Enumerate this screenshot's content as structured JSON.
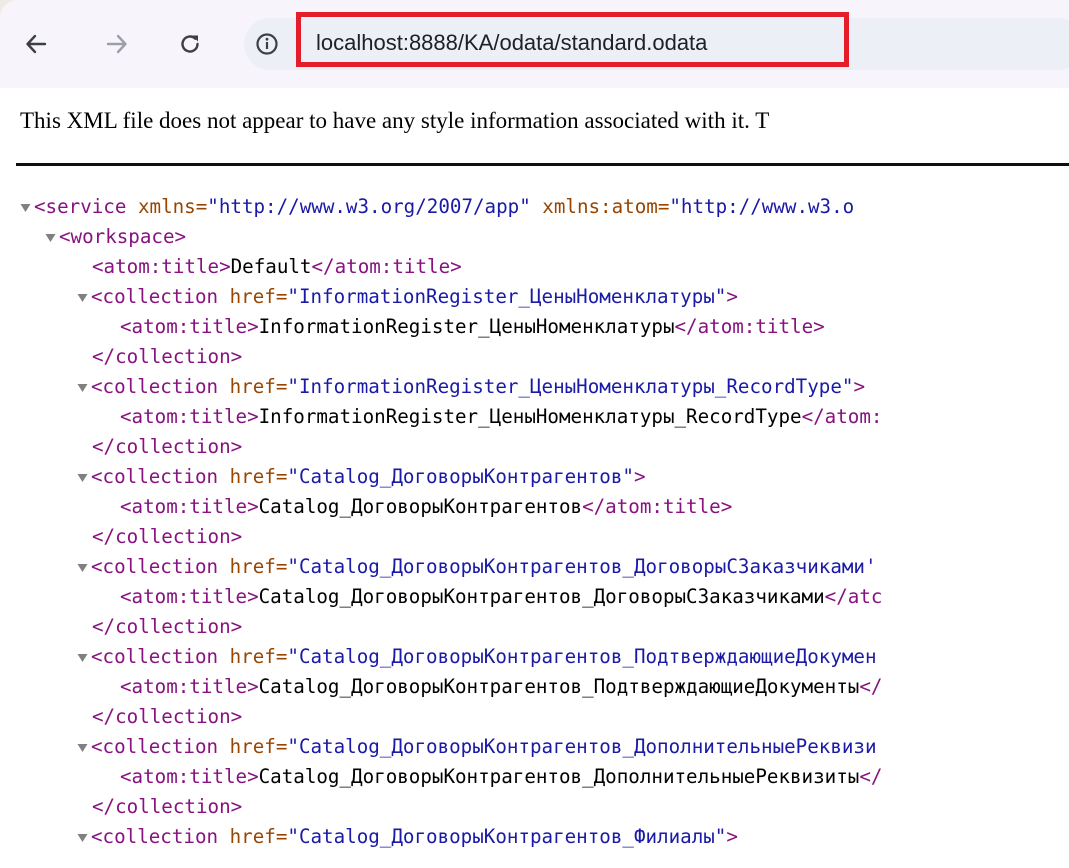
{
  "colors": {
    "tag": "#881280",
    "attribute_value": "#1a1aa6",
    "highlight": "#e51c2a"
  },
  "toolbar": {
    "back_icon": "arrow-left-icon",
    "forward_icon": "arrow-right-icon",
    "reload_icon": "reload-icon",
    "site_info_icon": "info-circle-icon",
    "url": "localhost:8888/KA/odata/standard.odata"
  },
  "page": {
    "banner": "This XML file does not appear to have any style information associated with it. T"
  },
  "xml": {
    "service_open": {
      "tag": "<service",
      "attr1": " xmlns=",
      "val1": "\"http://www.w3.org/2007/app\"",
      "attr2": " xmlns:atom=",
      "val2": "\"http://www.w3.o"
    },
    "workspace_open": "<workspace>",
    "default_title": {
      "open": "<atom:title>",
      "text": "Default",
      "close": "</atom:title>"
    },
    "collections": [
      {
        "href": "\"InformationRegister_ЦеныНоменклатуры\"",
        "end": ">",
        "title": "InformationRegister_ЦеныНоменклатуры",
        "title_close": "</atom:title>"
      },
      {
        "href": "\"InformationRegister_ЦеныНоменклатуры_RecordType\"",
        "end": ">",
        "title": "InformationRegister_ЦеныНоменклатуры_RecordType",
        "title_close": "</atom:"
      },
      {
        "href": "\"Catalog_ДоговорыКонтрагентов\"",
        "end": ">",
        "title": "Catalog_ДоговорыКонтрагентов",
        "title_close": "</atom:title>"
      },
      {
        "href": "\"Catalog_ДоговорыКонтрагентов_ДоговорыСЗаказчиками'",
        "end": "",
        "title": "Catalog_ДоговорыКонтрагентов_ДоговорыСЗаказчиками",
        "title_close": "</atc"
      },
      {
        "href": "\"Catalog_ДоговорыКонтрагентов_ПодтверждающиеДокумен",
        "end": "",
        "title": "Catalog_ДоговорыКонтрагентов_ПодтверждающиеДокументы",
        "title_close": "</"
      },
      {
        "href": "\"Catalog_ДоговорыКонтрагентов_ДополнительныеРеквизи",
        "end": "",
        "title": "Catalog_ДоговорыКонтрагентов_ДополнительныеРеквизиты",
        "title_close": "</"
      },
      {
        "href": "\"Catalog_ДоговорыКонтрагентов_Филиалы\"",
        "end": ">",
        "title": "",
        "title_close": ""
      }
    ],
    "collection_open": "<collection",
    "href_attr": " href=",
    "title_open": "<atom:title>",
    "collection_close": "</collection>"
  }
}
